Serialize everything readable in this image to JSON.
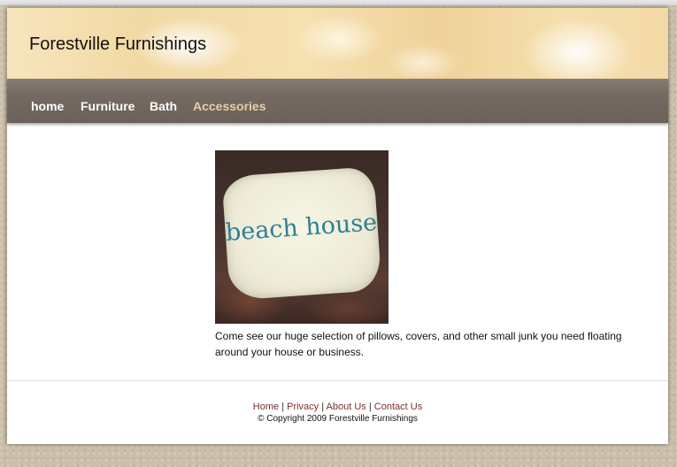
{
  "site": {
    "title": "Forestville Furnishings"
  },
  "nav": {
    "items": [
      {
        "label": "home",
        "active": false
      },
      {
        "label": "Furniture",
        "active": false
      },
      {
        "label": "Bath",
        "active": false
      },
      {
        "label": "Accessories",
        "active": true
      }
    ]
  },
  "main": {
    "image": {
      "icon": "pillow-photo",
      "pillow_text": "beach house"
    },
    "description": "Come see our huge selection of pillows, covers, and other small junk you need floating around your house or business."
  },
  "footer": {
    "links": [
      "Home",
      "Privacy",
      "About Us",
      "Contact Us"
    ],
    "separator": "|",
    "copyright": "© Copyright 2009 Forestville Furnishings"
  },
  "colors": {
    "nav_bg": "#756a61",
    "nav_active": "#e6cfa6",
    "footer_link": "#7a2f2f",
    "header_bg": "#f2d9a4"
  }
}
